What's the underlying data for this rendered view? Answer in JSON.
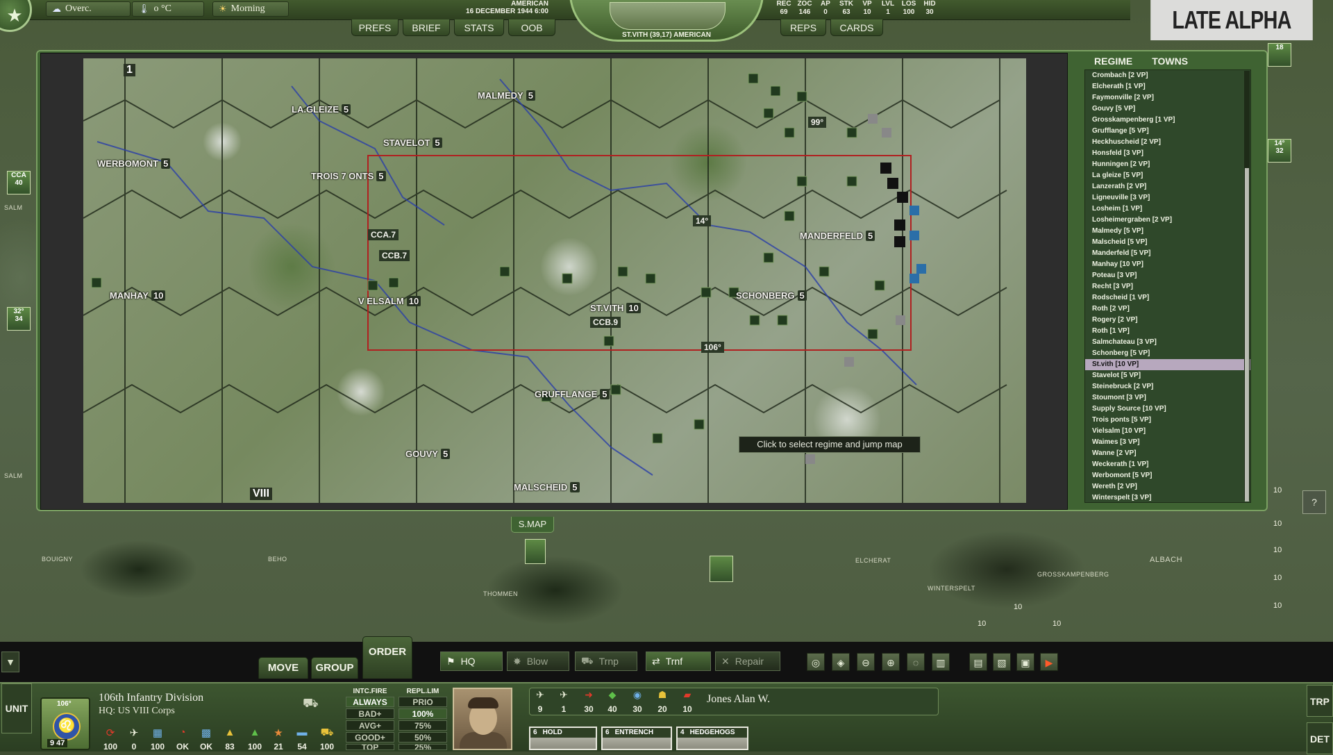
{
  "weather": {
    "sky": "Overc.",
    "temperature": "o °C",
    "time_of_day": "Morning"
  },
  "turn": {
    "side": "AMERICAN",
    "date": "16 DECEMBER 1944 6:00"
  },
  "hex_info": "ST.VITH (39,17) AMERICAN",
  "stats": [
    {
      "label": "REC",
      "value": "69"
    },
    {
      "label": "ZOC",
      "value": "146"
    },
    {
      "label": "AP",
      "value": "0"
    },
    {
      "label": "STK",
      "value": "63"
    },
    {
      "label": "VP",
      "value": "10"
    },
    {
      "label": "LVL",
      "value": "1"
    },
    {
      "label": "LOS",
      "value": "100"
    },
    {
      "label": "HID",
      "value": "30"
    }
  ],
  "nav_left": [
    "PREFS",
    "BRIEF",
    "STATS",
    "OOB"
  ],
  "nav_right": [
    "REPS",
    "CARDS"
  ],
  "build_label": "LATE ALPHA",
  "minimap": {
    "towns": [
      {
        "name": "LA.GLEIZE",
        "vp": "5"
      },
      {
        "name": "MALMEDY",
        "vp": "5"
      },
      {
        "name": "STAVELOT",
        "vp": "5"
      },
      {
        "name": "WERBOMONT",
        "vp": "5"
      },
      {
        "name": "TROIS 7 ONTS",
        "vp": "5"
      },
      {
        "name": "MANDERFELD",
        "vp": "5"
      },
      {
        "name": "MANHAY",
        "vp": "10"
      },
      {
        "name": "V ELSALM",
        "vp": "10"
      },
      {
        "name": "ST.VITH",
        "vp": "10"
      },
      {
        "name": "SCHONBERG",
        "vp": "5"
      },
      {
        "name": "GRUFFLANGE",
        "vp": "5"
      },
      {
        "name": "GOUVY",
        "vp": "5"
      },
      {
        "name": "MALSCHEID",
        "vp": "5"
      }
    ],
    "units": [
      "CCA.7",
      "CCB.7",
      "CCB.9",
      "14°",
      "99°",
      "106°"
    ],
    "corner_top": "1",
    "corner_bottom": "VIII",
    "tooltip": "Click to select regime and jump map",
    "smap_label": "S.MAP"
  },
  "town_tabs": [
    "REGIME",
    "TOWNS"
  ],
  "towns_list": [
    "Crombach [2 VP]",
    "Elcherath [1 VP]",
    "Faymonville [2 VP]",
    "Gouvy [5 VP]",
    "Grosskampenberg [1 VP]",
    "Grufflange [5 VP]",
    "Heckhuscheid [2 VP]",
    "Honsfeld [3 VP]",
    "Hunningen [2 VP]",
    "La gleize [5 VP]",
    "Lanzerath [2 VP]",
    "Ligneuville [3 VP]",
    "Losheim [1 VP]",
    "Losheimergraben [2 VP]",
    "Malmedy [5 VP]",
    "Malscheid [5 VP]",
    "Manderfeld [5 VP]",
    "Manhay [10 VP]",
    "Poteau [3 VP]",
    "Recht [3 VP]",
    "Rodscheid [1 VP]",
    "Roth [2 VP]",
    "Rogery [2 VP]",
    "Roth [1 VP]",
    "Salmchateau [3 VP]",
    "Schonberg [5 VP]",
    "St.vith [10 VP]",
    "Stavelot [5 VP]",
    "Steinebruck [2 VP]",
    "Stoumont [3 VP]",
    "Supply Source [10 VP]",
    "Trois ponts [5 VP]",
    "Vielsalm [10 VP]",
    "Waimes [3 VP]",
    "Wanne [2 VP]",
    "Weckerath [1 VP]",
    "Werbomont [5 VP]",
    "Wereth [2 VP]",
    "Winterspelt [3 VP]"
  ],
  "towns_selected": "St.vith [10 VP]",
  "background_map": {
    "towns": [
      "BOUIGNY",
      "BEHO",
      "THOMMEN",
      "ELCHERAT",
      "WINTERSPELT",
      "GROSSKAMPENBERG"
    ],
    "numbers": [
      "10",
      "10",
      "10",
      "10",
      "10",
      "10",
      "10",
      "10"
    ],
    "region": "ALBACH",
    "left_labels": [
      "SALM",
      "SALM"
    ]
  },
  "order_tabs": [
    "MOVE",
    "GROUP",
    "ORDER"
  ],
  "actions": [
    {
      "label": "HQ",
      "icon": "flag-icon",
      "active": true
    },
    {
      "label": "Blow",
      "icon": "explosion-icon",
      "active": false
    },
    {
      "label": "Trnp",
      "icon": "transport-icon",
      "active": false
    },
    {
      "label": "Trnf",
      "icon": "transfer-icon",
      "active": true
    },
    {
      "label": "Repair",
      "icon": "wrench-icon",
      "active": false
    }
  ],
  "unit": {
    "tab_label": "UNIT",
    "name": "106th Infantry Division",
    "hq": "HQ: US VIII Corps",
    "size": "106°",
    "strength": "9 47",
    "stats": [
      {
        "icon": "recycle-icon",
        "value": "100"
      },
      {
        "icon": "plane-icon",
        "value": "0"
      },
      {
        "icon": "supply-icon",
        "value": "100"
      },
      {
        "icon": "readiness-icon",
        "value": "OK"
      },
      {
        "icon": "supply-truck-icon",
        "value": "OK"
      },
      {
        "icon": "ammo-icon",
        "value": "83"
      },
      {
        "icon": "troops-icon",
        "value": "100"
      },
      {
        "icon": "morale-icon",
        "value": "21"
      },
      {
        "icon": "vehicles-icon",
        "value": "54"
      },
      {
        "icon": "fuel-icon",
        "value": "100"
      }
    ],
    "intc_fire": {
      "label": "INTC.FIRE",
      "options": [
        "ALWAYS",
        "BAD+",
        "AVG+",
        "GOOD+",
        "TOP"
      ],
      "selected": "ALWAYS"
    },
    "repl_lim": {
      "label": "REPL.LIM",
      "options": [
        "PRIO",
        "100%",
        "75%",
        "50%",
        "25%"
      ],
      "selected": "100%"
    }
  },
  "leader": {
    "name": "Jones Alan W.",
    "stats": [
      {
        "icon": "plane-icon",
        "value": "9"
      },
      {
        "icon": "plane-down-icon",
        "value": "1"
      },
      {
        "icon": "attack-icon",
        "value": "30"
      },
      {
        "icon": "defense-icon",
        "value": "40"
      },
      {
        "icon": "recon-icon",
        "value": "30"
      },
      {
        "icon": "soldier-icon",
        "value": "20"
      },
      {
        "icon": "artillery-icon",
        "value": "10"
      }
    ],
    "cards": [
      {
        "cost": "6",
        "name": "HOLD"
      },
      {
        "cost": "6",
        "name": "ENTRENCH"
      },
      {
        "cost": "4",
        "name": "HEDGEHOGS"
      }
    ]
  },
  "side_buttons": [
    "TRP",
    "DET"
  ],
  "help_label": "?",
  "counters": [
    {
      "label": "CCA",
      "value": "40"
    },
    {
      "label": "32°",
      "value": "34"
    },
    {
      "label": "",
      "value": "18"
    },
    {
      "label": "14°",
      "value": "32"
    }
  ],
  "colors": {
    "panel_green": "#3f6332",
    "highlight": "#b7a8be",
    "border": "#7aa062",
    "box_red": "#b02020"
  }
}
